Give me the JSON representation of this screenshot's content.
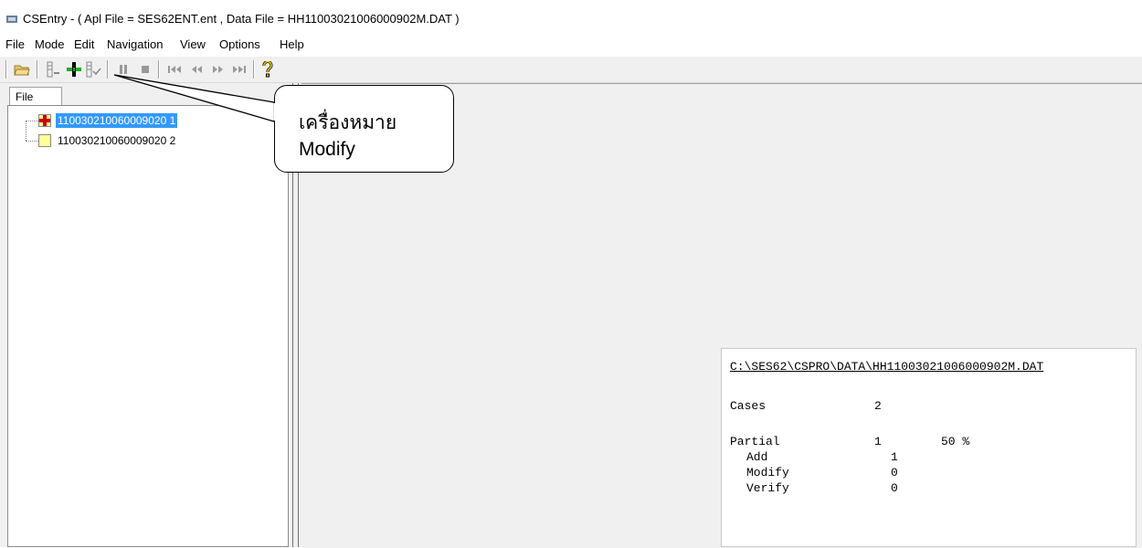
{
  "window": {
    "title": "CSEntry - ( Apl File = SES62ENT.ent , Data File = HH11003021006000902M.DAT )",
    "icon": "csentry-app-icon"
  },
  "menu": [
    "File",
    "Mode",
    "Edit",
    "Navigation",
    "View",
    "Options",
    "Help"
  ],
  "toolbar": {
    "buttons": [
      {
        "name": "open-icon"
      },
      {
        "name": "add-case-icon"
      },
      {
        "name": "modify-case-icon"
      },
      {
        "name": "verify-case-icon"
      },
      {
        "name": "pause-icon"
      },
      {
        "name": "stop-icon"
      },
      {
        "name": "first-case-icon"
      },
      {
        "name": "previous-case-icon"
      },
      {
        "name": "next-case-icon"
      },
      {
        "name": "last-case-icon"
      },
      {
        "name": "help-icon"
      }
    ]
  },
  "left_panel": {
    "tab": "File",
    "cases": [
      {
        "id": "110030210060009020​1",
        "label": "110030210060009020 1",
        "status": "partial-add",
        "selected": true
      },
      {
        "id": "110030210060009020​2",
        "label": "110030210060009020 2",
        "status": "complete",
        "selected": false
      }
    ]
  },
  "stats_panel": {
    "path": "C:\\SES62\\CSPRO\\DATA\\HH11003021006000902M.DAT",
    "cases_label": "Cases",
    "cases_value": "2",
    "partial_label": "Partial",
    "partial_value": "1",
    "partial_percent": "50 %",
    "add_label": "Add",
    "add_value": "1",
    "modify_label": "Modify",
    "modify_value": "0",
    "verify_label": "Verify",
    "verify_value": "0"
  },
  "callout": {
    "line1": "เครื่องหมาย",
    "line2": "Modify"
  },
  "colors": {
    "selection": "#3399ff",
    "partial_icon": "#cc0000",
    "complete_icon": "#ffff99"
  }
}
